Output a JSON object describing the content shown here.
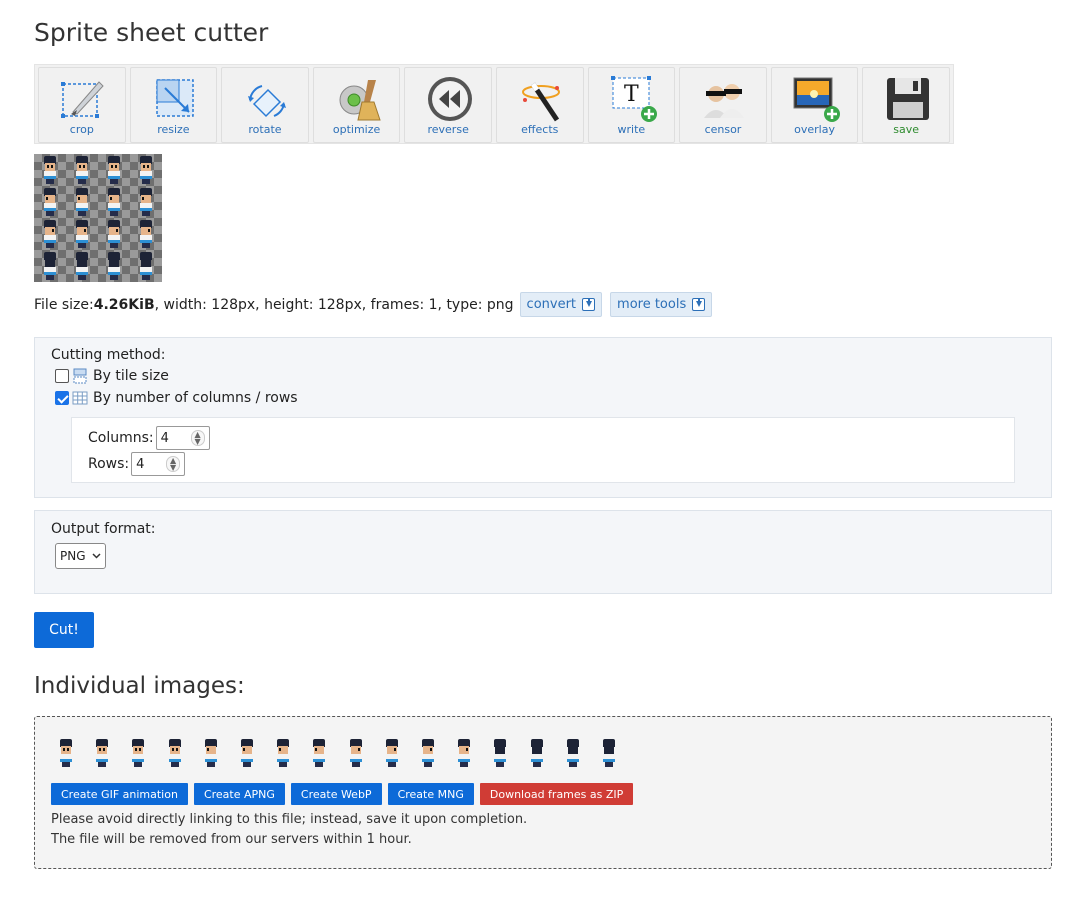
{
  "page": {
    "title": "Sprite sheet cutter"
  },
  "toolbar": {
    "tools": [
      {
        "label": "crop",
        "icon": "crop-icon"
      },
      {
        "label": "resize",
        "icon": "resize-icon"
      },
      {
        "label": "rotate",
        "icon": "rotate-icon"
      },
      {
        "label": "optimize",
        "icon": "optimize-icon"
      },
      {
        "label": "reverse",
        "icon": "reverse-icon"
      },
      {
        "label": "effects",
        "icon": "effects-icon"
      },
      {
        "label": "write",
        "icon": "write-icon"
      },
      {
        "label": "censor",
        "icon": "censor-icon"
      },
      {
        "label": "overlay",
        "icon": "overlay-icon"
      },
      {
        "label": "save",
        "icon": "save-icon"
      }
    ]
  },
  "fileinfo": {
    "prefix": "File size: ",
    "size": "4.26KiB",
    "rest": ", width: 128px, height: 128px, frames: 1, type: png",
    "convert": "convert",
    "more_tools": "more tools"
  },
  "cutting": {
    "label": "Cutting method:",
    "by_tile": "By tile size",
    "by_tile_checked": false,
    "by_grid": "By number of columns / rows",
    "by_grid_checked": true,
    "columns_label": "Columns:",
    "columns_value": "4",
    "rows_label": "Rows:",
    "rows_value": "4"
  },
  "output": {
    "label": "Output format:",
    "format": "PNG"
  },
  "cut_button": "Cut!",
  "individual": {
    "heading": "Individual images:",
    "frame_count": 16,
    "buttons": {
      "gif": "Create GIF animation",
      "apng": "Create APNG",
      "webp": "Create WebP",
      "mng": "Create MNG",
      "zip": "Download frames as ZIP"
    },
    "note1": "Please avoid directly linking to this file; instead, save it upon completion.",
    "note2": "The file will be removed from our servers within 1 hour."
  },
  "colors": {
    "accent": "#0d6ad8",
    "danger": "#d03c35",
    "link": "#2c6fb7",
    "save": "#2e8b2e"
  }
}
